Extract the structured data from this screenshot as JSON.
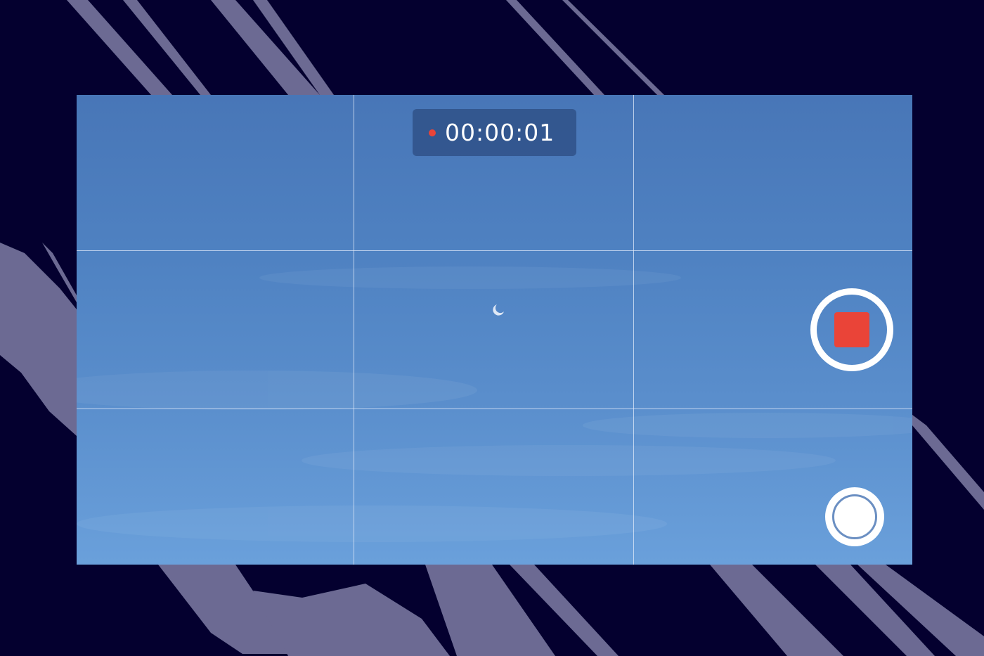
{
  "camera": {
    "timer": "00:00:01",
    "recording_indicator": "rec-dot",
    "record_button_icon": "stop-icon",
    "shutter_button_icon": "shutter-icon"
  },
  "colors": {
    "background": "#04002f",
    "streaks": "#6c6a93",
    "recording_red": "#ea4438",
    "grid_line": "#e1ebfa",
    "sky_top": "#4876b7",
    "sky_bottom": "#6aa0db"
  }
}
